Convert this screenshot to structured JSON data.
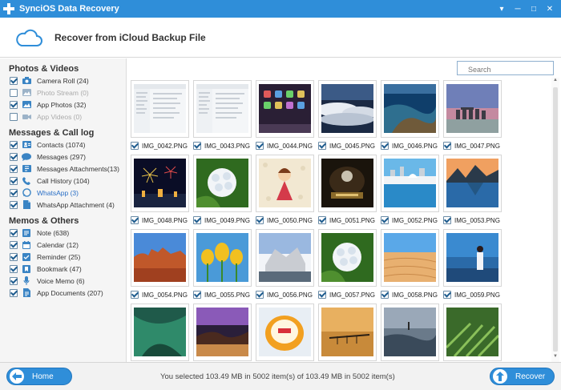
{
  "window": {
    "title": "SynciOS Data Recovery",
    "controls": [
      "▾",
      "─",
      "□",
      "✕"
    ]
  },
  "header": {
    "title": "Recover from iCloud Backup File"
  },
  "sidebar": {
    "sections": [
      {
        "title": "Photos & Videos",
        "items": [
          {
            "label": "Camera Roll (24)",
            "checked": true,
            "dim": false,
            "icon": "camera-icon"
          },
          {
            "label": "Photo Stream (0)",
            "checked": false,
            "dim": true,
            "icon": "photo-stream-icon"
          },
          {
            "label": "App Photos (32)",
            "checked": true,
            "dim": false,
            "icon": "image-icon"
          },
          {
            "label": "App Videos (0)",
            "checked": false,
            "dim": true,
            "icon": "video-icon"
          }
        ]
      },
      {
        "title": "Messages & Call log",
        "items": [
          {
            "label": "Contacts (1074)",
            "checked": true,
            "dim": false,
            "icon": "contacts-icon"
          },
          {
            "label": "Messages (297)",
            "checked": true,
            "dim": false,
            "icon": "messages-icon"
          },
          {
            "label": "Messages Attachments(13)",
            "checked": true,
            "dim": false,
            "icon": "attachment-icon"
          },
          {
            "label": "Call History (104)",
            "checked": true,
            "dim": false,
            "icon": "phone-icon"
          },
          {
            "label": "WhatsApp (3)",
            "checked": true,
            "dim": false,
            "active": true,
            "icon": "whatsapp-icon"
          },
          {
            "label": "WhatsApp Attachment (4)",
            "checked": true,
            "dim": false,
            "icon": "whatsapp-attachment-icon"
          }
        ]
      },
      {
        "title": "Memos & Others",
        "items": [
          {
            "label": "Note (638)",
            "checked": true,
            "dim": false,
            "icon": "note-icon"
          },
          {
            "label": "Calendar (12)",
            "checked": true,
            "dim": false,
            "icon": "calendar-icon"
          },
          {
            "label": "Reminder (25)",
            "checked": true,
            "dim": false,
            "icon": "reminder-icon"
          },
          {
            "label": "Bookmark (47)",
            "checked": true,
            "dim": false,
            "icon": "bookmark-icon"
          },
          {
            "label": "Voice Memo (6)",
            "checked": true,
            "dim": false,
            "icon": "microphone-icon"
          },
          {
            "label": "App Documents (207)",
            "checked": true,
            "dim": false,
            "icon": "document-icon"
          }
        ]
      }
    ]
  },
  "search": {
    "placeholder": "Search"
  },
  "photos": [
    {
      "name": "IMG_0042.PNG",
      "checked": true,
      "thumb": "screenshot"
    },
    {
      "name": "IMG_0043.PNG",
      "checked": true,
      "thumb": "screenshot"
    },
    {
      "name": "IMG_0044.PNG",
      "checked": true,
      "thumb": "homescreen"
    },
    {
      "name": "IMG_0045.PNG",
      "checked": true,
      "thumb": "clouds"
    },
    {
      "name": "IMG_0046.PNG",
      "checked": true,
      "thumb": "coast"
    },
    {
      "name": "IMG_0047.PNG",
      "checked": true,
      "thumb": "stonehenge"
    },
    {
      "name": "IMG_0048.PNG",
      "checked": true,
      "thumb": "fireworks"
    },
    {
      "name": "IMG_0049.PNG",
      "checked": true,
      "thumb": "hydrangea"
    },
    {
      "name": "IMG_0050.PNG",
      "checked": true,
      "thumb": "doll"
    },
    {
      "name": "IMG_0051.PNG",
      "checked": true,
      "thumb": "pirates"
    },
    {
      "name": "IMG_0052.PNG",
      "checked": true,
      "thumb": "harbor"
    },
    {
      "name": "IMG_0053.PNG",
      "checked": true,
      "thumb": "lake"
    },
    {
      "name": "IMG_0054.PNG",
      "checked": true,
      "thumb": "desert"
    },
    {
      "name": "IMG_0055.PNG",
      "checked": true,
      "thumb": "tulips"
    },
    {
      "name": "IMG_0056.PNG",
      "checked": true,
      "thumb": "building"
    },
    {
      "name": "IMG_0057.PNG",
      "checked": true,
      "thumb": "hydrangea"
    },
    {
      "name": "IMG_0058.PNG",
      "checked": true,
      "thumb": "sand"
    },
    {
      "name": "IMG_0059.PNG",
      "checked": true,
      "thumb": "girl"
    },
    {
      "name": "",
      "checked": false,
      "thumb": "forest"
    },
    {
      "name": "",
      "checked": false,
      "thumb": "sunset"
    },
    {
      "name": "",
      "checked": false,
      "thumb": "cake"
    },
    {
      "name": "",
      "checked": false,
      "thumb": "pier"
    },
    {
      "name": "",
      "checked": false,
      "thumb": "sea"
    },
    {
      "name": "",
      "checked": false,
      "thumb": "greenfield"
    }
  ],
  "footer": {
    "home_label": "Home",
    "recover_label": "Recover",
    "status": "You selected 103.49 MB in 5002 item(s) of 103.49 MB in 5002 item(s)"
  },
  "colors": {
    "accent": "#2f8ed9",
    "active_link": "#2a6fc6"
  }
}
